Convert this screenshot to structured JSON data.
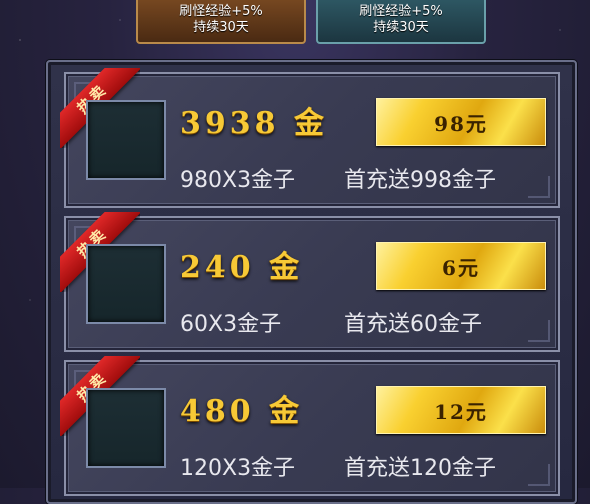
{
  "buffs": [
    {
      "line1": "刷怪经验+5%",
      "line2": "持续30天",
      "color": "#7a4a22"
    },
    {
      "line1": "刷怪经验+5%",
      "line2": "持续30天",
      "color": "#2f5a66"
    }
  ],
  "ribbon_label": "热卖",
  "packages": [
    {
      "amount": "3938",
      "unit": "金",
      "price": "98元",
      "base": "980X3金子",
      "bonus": "首充送998金子"
    },
    {
      "amount": "240",
      "unit": "金",
      "price": "6元",
      "base": "60X3金子",
      "bonus": "首充送60金子"
    },
    {
      "amount": "480",
      "unit": "金",
      "price": "12元",
      "base": "120X3金子",
      "bonus": "首充送120金子"
    }
  ]
}
